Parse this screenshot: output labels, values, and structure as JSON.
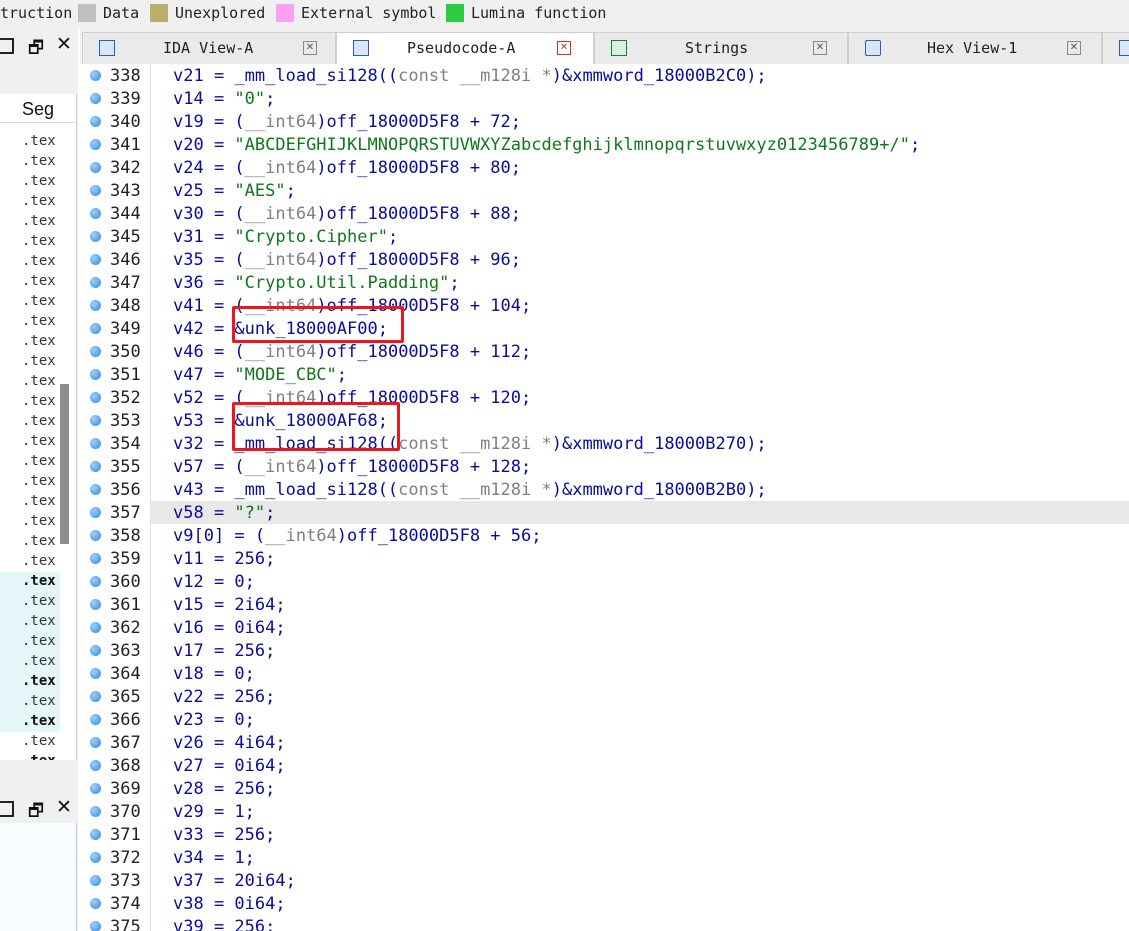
{
  "legend": [
    {
      "label": "truction",
      "color": ""
    },
    {
      "label": "Data",
      "color": "#c0c0c0"
    },
    {
      "label": "Unexplored",
      "color": "#b9b06e"
    },
    {
      "label": "External symbol",
      "color": "#ff9ff0"
    },
    {
      "label": "Lumina function",
      "color": "#2ecc40"
    }
  ],
  "left_panel": {
    "segments_header": "Seg",
    "items": [
      ".tex",
      ".tex",
      ".tex",
      ".tex",
      ".tex",
      ".tex",
      ".tex",
      ".tex",
      ".tex",
      ".tex",
      ".tex",
      ".tex",
      ".tex",
      ".tex",
      ".tex",
      ".tex",
      ".tex",
      ".tex",
      ".tex",
      ".tex",
      ".tex",
      ".tex",
      ".tex",
      ".tex",
      ".tex",
      ".tex",
      ".tex",
      ".tex",
      ".tex",
      ".tex",
      ".tex",
      ".tex",
      ".tex"
    ]
  },
  "tabs": [
    {
      "label": "IDA View-A",
      "active": false
    },
    {
      "label": "Pseudocode-A",
      "active": true
    },
    {
      "label": "Strings",
      "active": false
    },
    {
      "label": "Hex View-1",
      "active": false
    }
  ],
  "code": {
    "current_line": 357,
    "lines": [
      {
        "no": "338",
        "text": "v21 = _mm_load_si128((const __m128i *)&xmmword_18000B2C0);"
      },
      {
        "no": "339",
        "text": "v14 = \"0\";"
      },
      {
        "no": "340",
        "text": "v19 = (__int64)off_18000D5F8 + 72;"
      },
      {
        "no": "341",
        "text": "v20 = \"ABCDEFGHIJKLMNOPQRSTUVWXYZabcdefghijklmnopqrstuvwxyz0123456789+/\";"
      },
      {
        "no": "342",
        "text": "v24 = (__int64)off_18000D5F8 + 80;"
      },
      {
        "no": "343",
        "text": "v25 = \"AES\";"
      },
      {
        "no": "344",
        "text": "v30 = (__int64)off_18000D5F8 + 88;"
      },
      {
        "no": "345",
        "text": "v31 = \"Crypto.Cipher\";"
      },
      {
        "no": "346",
        "text": "v35 = (__int64)off_18000D5F8 + 96;"
      },
      {
        "no": "347",
        "text": "v36 = \"Crypto.Util.Padding\";"
      },
      {
        "no": "348",
        "text": "v41 = (__int64)off_18000D5F8 + 104;"
      },
      {
        "no": "349",
        "text": "v42 = &unk_18000AF00;"
      },
      {
        "no": "350",
        "text": "v46 = (__int64)off_18000D5F8 + 112;"
      },
      {
        "no": "351",
        "text": "v47 = \"MODE_CBC\";"
      },
      {
        "no": "352",
        "text": "v52 = (__int64)off_18000D5F8 + 120;"
      },
      {
        "no": "353",
        "text": "v53 = &unk_18000AF68;"
      },
      {
        "no": "354",
        "text": "v32 = _mm_load_si128((const __m128i *)&xmmword_18000B270);"
      },
      {
        "no": "355",
        "text": "v57 = (__int64)off_18000D5F8 + 128;"
      },
      {
        "no": "356",
        "text": "v43 = _mm_load_si128((const __m128i *)&xmmword_18000B2B0);"
      },
      {
        "no": "357",
        "text": "v58 = \"?\";"
      },
      {
        "no": "358",
        "text": "v9[0] = (__int64)off_18000D5F8 + 56;"
      },
      {
        "no": "359",
        "text": "v11 = 256;"
      },
      {
        "no": "360",
        "text": "v12 = 0;"
      },
      {
        "no": "361",
        "text": "v15 = 2i64;"
      },
      {
        "no": "362",
        "text": "v16 = 0i64;"
      },
      {
        "no": "363",
        "text": "v17 = 256;"
      },
      {
        "no": "364",
        "text": "v18 = 0;"
      },
      {
        "no": "365",
        "text": "v22 = 256;"
      },
      {
        "no": "366",
        "text": "v23 = 0;"
      },
      {
        "no": "367",
        "text": "v26 = 4i64;"
      },
      {
        "no": "368",
        "text": "v27 = 0i64;"
      },
      {
        "no": "369",
        "text": "v28 = 256;"
      },
      {
        "no": "370",
        "text": "v29 = 1;"
      },
      {
        "no": "371",
        "text": "v33 = 256;"
      },
      {
        "no": "372",
        "text": "v34 = 1;"
      },
      {
        "no": "373",
        "text": "v37 = 20i64;"
      },
      {
        "no": "374",
        "text": "v38 = 0i64;"
      },
      {
        "no": "375",
        "text": "v39 = 256;"
      }
    ]
  },
  "highlights": [
    "&unk_18000AF00;",
    "&unk_18000AF68"
  ],
  "colors": {
    "highlight_box": "#e8191d",
    "string_literal": "#11771b",
    "identifier": "#0b0b9c"
  }
}
